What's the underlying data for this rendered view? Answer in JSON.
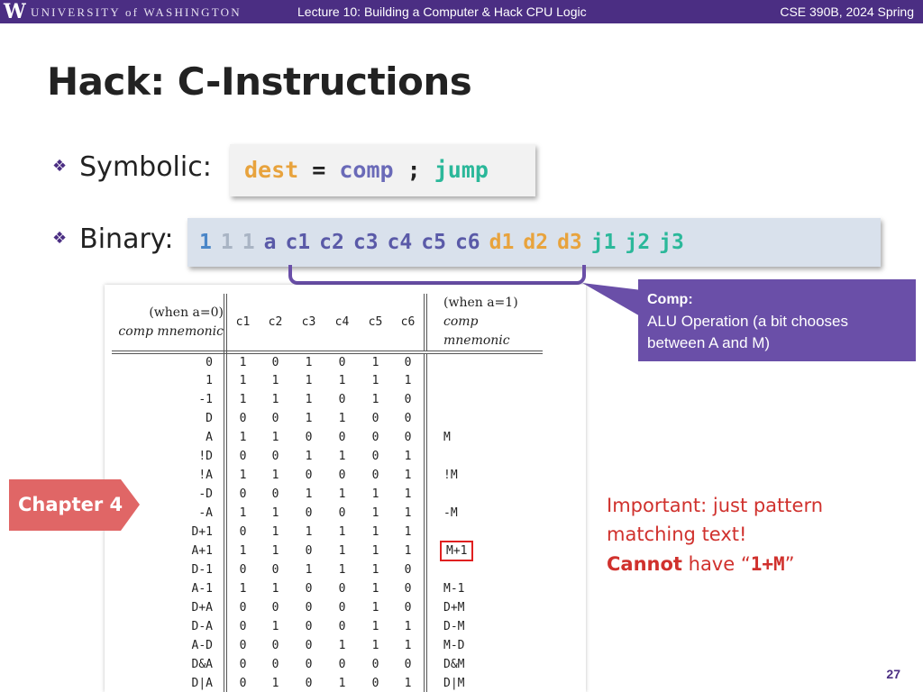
{
  "header": {
    "logo_letter": "W",
    "university": "UNIVERSITY of WASHINGTON",
    "lecture_title": "Lecture 10: Building a Computer & Hack CPU Logic",
    "course": "CSE 390B, 2024 Spring"
  },
  "slide": {
    "title": "Hack: C-Instructions",
    "page_number": "27"
  },
  "bullets": {
    "symbolic_label": "Symbolic:",
    "binary_label": "Binary:"
  },
  "symbolic": {
    "dest": "dest",
    "eq": " = ",
    "comp": "comp",
    "semi": " ; ",
    "jump": "jump"
  },
  "binary_bits": [
    {
      "text": "1",
      "kind": "hi"
    },
    {
      "text": "1",
      "kind": "lo"
    },
    {
      "text": "1",
      "kind": "lo"
    },
    {
      "text": "a",
      "kind": "a"
    },
    {
      "text": "c1",
      "kind": "c"
    },
    {
      "text": "c2",
      "kind": "c"
    },
    {
      "text": "c3",
      "kind": "c"
    },
    {
      "text": "c4",
      "kind": "c"
    },
    {
      "text": "c5",
      "kind": "c"
    },
    {
      "text": "c6",
      "kind": "c"
    },
    {
      "text": "d1",
      "kind": "d"
    },
    {
      "text": "d2",
      "kind": "d"
    },
    {
      "text": "d3",
      "kind": "d"
    },
    {
      "text": "j1",
      "kind": "j"
    },
    {
      "text": "j2",
      "kind": "j"
    },
    {
      "text": "j3",
      "kind": "j"
    }
  ],
  "callout": {
    "title": "Comp:",
    "body": "ALU Operation (a bit chooses between A and M)"
  },
  "table": {
    "left_header_line1": "(when a=0)",
    "left_header_line2": "comp mnemonic",
    "right_header_line1": "(when a=1)",
    "right_header_line2": "comp mnemonic",
    "bit_headers": [
      "c1",
      "c2",
      "c3",
      "c4",
      "c5",
      "c6"
    ],
    "rows": [
      {
        "left": "0",
        "bits": [
          "1",
          "0",
          "1",
          "0",
          "1",
          "0"
        ],
        "right": ""
      },
      {
        "left": "1",
        "bits": [
          "1",
          "1",
          "1",
          "1",
          "1",
          "1"
        ],
        "right": ""
      },
      {
        "left": "-1",
        "bits": [
          "1",
          "1",
          "1",
          "0",
          "1",
          "0"
        ],
        "right": ""
      },
      {
        "left": "D",
        "bits": [
          "0",
          "0",
          "1",
          "1",
          "0",
          "0"
        ],
        "right": ""
      },
      {
        "left": "A",
        "bits": [
          "1",
          "1",
          "0",
          "0",
          "0",
          "0"
        ],
        "right": "M"
      },
      {
        "left": "!D",
        "bits": [
          "0",
          "0",
          "1",
          "1",
          "0",
          "1"
        ],
        "right": ""
      },
      {
        "left": "!A",
        "bits": [
          "1",
          "1",
          "0",
          "0",
          "0",
          "1"
        ],
        "right": "!M"
      },
      {
        "left": "-D",
        "bits": [
          "0",
          "0",
          "1",
          "1",
          "1",
          "1"
        ],
        "right": ""
      },
      {
        "left": "-A",
        "bits": [
          "1",
          "1",
          "0",
          "0",
          "1",
          "1"
        ],
        "right": "-M"
      },
      {
        "left": "D+1",
        "bits": [
          "0",
          "1",
          "1",
          "1",
          "1",
          "1"
        ],
        "right": ""
      },
      {
        "left": "A+1",
        "bits": [
          "1",
          "1",
          "0",
          "1",
          "1",
          "1"
        ],
        "right": "M+1"
      },
      {
        "left": "D-1",
        "bits": [
          "0",
          "0",
          "1",
          "1",
          "1",
          "0"
        ],
        "right": ""
      },
      {
        "left": "A-1",
        "bits": [
          "1",
          "1",
          "0",
          "0",
          "1",
          "0"
        ],
        "right": "M-1"
      },
      {
        "left": "D+A",
        "bits": [
          "0",
          "0",
          "0",
          "0",
          "1",
          "0"
        ],
        "right": "D+M"
      },
      {
        "left": "D-A",
        "bits": [
          "0",
          "1",
          "0",
          "0",
          "1",
          "1"
        ],
        "right": "D-M"
      },
      {
        "left": "A-D",
        "bits": [
          "0",
          "0",
          "0",
          "1",
          "1",
          "1"
        ],
        "right": "M-D"
      },
      {
        "left": "D&A",
        "bits": [
          "0",
          "0",
          "0",
          "0",
          "0",
          "0"
        ],
        "right": "D&M"
      },
      {
        "left": "D|A",
        "bits": [
          "0",
          "1",
          "0",
          "1",
          "0",
          "1"
        ],
        "right": "D|M"
      }
    ],
    "highlighted_right": "M+1"
  },
  "chapter_tag": "Chapter 4",
  "note": {
    "line1": "Important: just pattern",
    "line2": "matching text!",
    "cannot": "Cannot",
    "have": " have “",
    "expr": "1+M",
    "close": "”"
  },
  "colors": {
    "uw_purple": "#4b2e83",
    "callout_purple": "#6a4fa8",
    "dest_orange": "#e8a33d",
    "jump_teal": "#2bb89a",
    "comp_blue": "#6a6ab8",
    "note_red": "#d0312d",
    "chapter_red": "#e06666"
  }
}
